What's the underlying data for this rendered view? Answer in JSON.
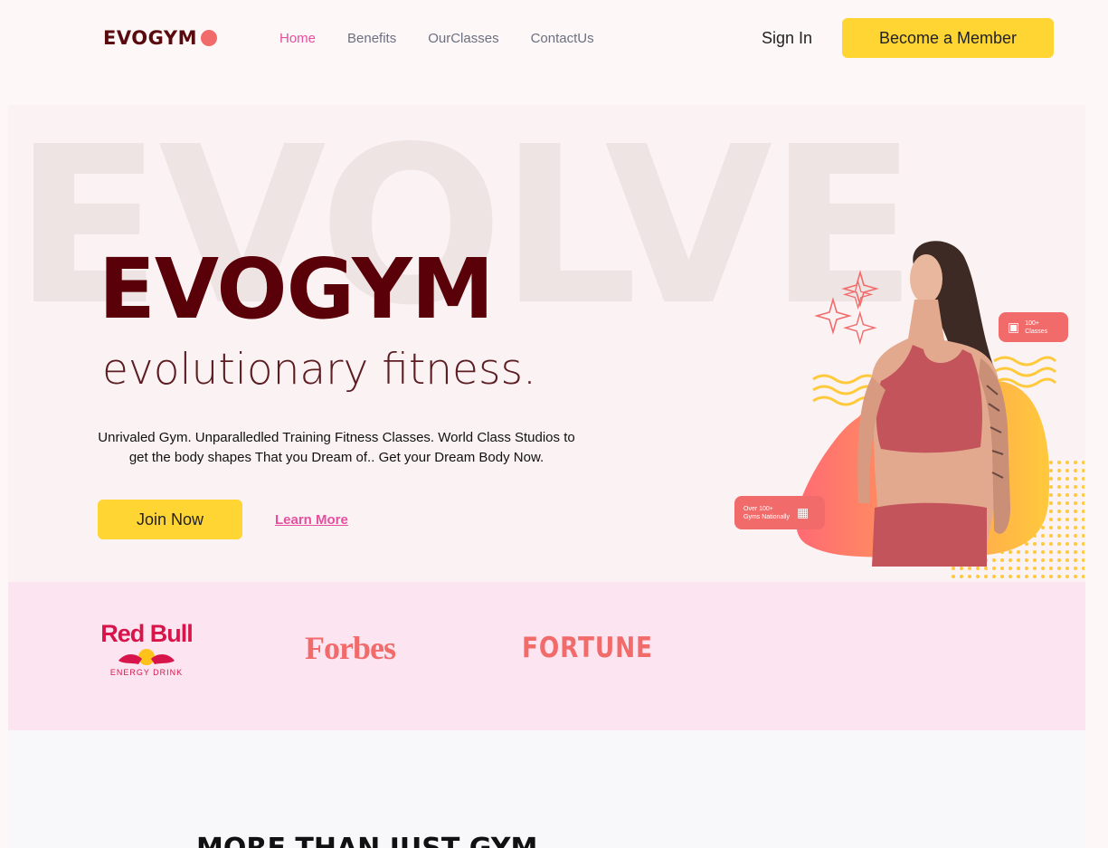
{
  "nav": {
    "logo": "EVOGYM",
    "links": [
      "Home",
      "Benefits",
      "OurClasses",
      "ContactUs"
    ],
    "signin": "Sign In",
    "member_button": "Become a Member"
  },
  "hero": {
    "background_word": "EVOLVE",
    "title": "EVOGYM",
    "subtitle": "evolutionary fitness.",
    "description": "Unrivaled Gym. Unparalledled Training Fitness Classes. World Class Studios to get the body shapes That you Dream of.. Get your Dream Body Now.",
    "join_button": "Join Now",
    "learn_more": "Learn More",
    "badge_classes_line1": "100+",
    "badge_classes_line2": "Classes",
    "badge_gyms_line1": "Over 100+",
    "badge_gyms_line2": "Gyms Nationally"
  },
  "sponsors": {
    "redbull": "Red Bull",
    "redbull_sub": "ENERGY DRINK",
    "forbes": "Forbes",
    "fortune": "FORTUNE"
  },
  "benefits": {
    "title": "MORE THAN JUST GYM"
  },
  "colors": {
    "accent_yellow": "#ffd534",
    "accent_pink": "#e64fa0",
    "brand_dark": "#5a0008",
    "coral": "#f26b6b",
    "sponsor_bg": "#fce5f1"
  }
}
